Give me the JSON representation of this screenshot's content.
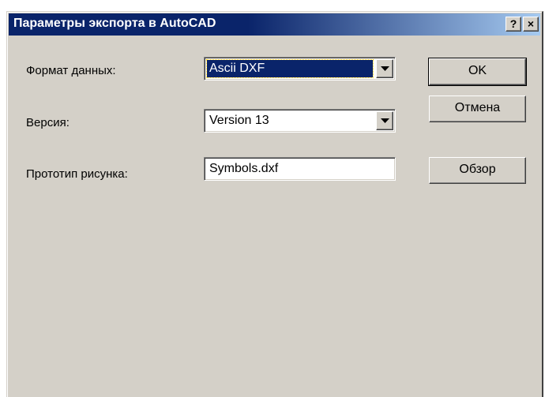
{
  "window": {
    "title": "Параметры экспорта в AutoCAD",
    "help_button": "?",
    "close_button": "×"
  },
  "form": {
    "data_format": {
      "label": "Формат данных:",
      "value": "Ascii DXF"
    },
    "version": {
      "label": "Версия:",
      "value": "Version 13"
    },
    "prototype": {
      "label": "Прототип рисунка:",
      "value": "Symbols.dxf"
    }
  },
  "buttons": {
    "ok": "OK",
    "cancel": "Отмена",
    "browse": "Обзор"
  },
  "icons": {
    "dropdown": "chevron-down-icon",
    "help": "help-icon",
    "close": "close-icon"
  },
  "colors": {
    "titlebar_start": "#0a246a",
    "titlebar_end": "#a6caf0",
    "dialog_bg": "#d4d0c8",
    "selection": "#0a246a"
  }
}
